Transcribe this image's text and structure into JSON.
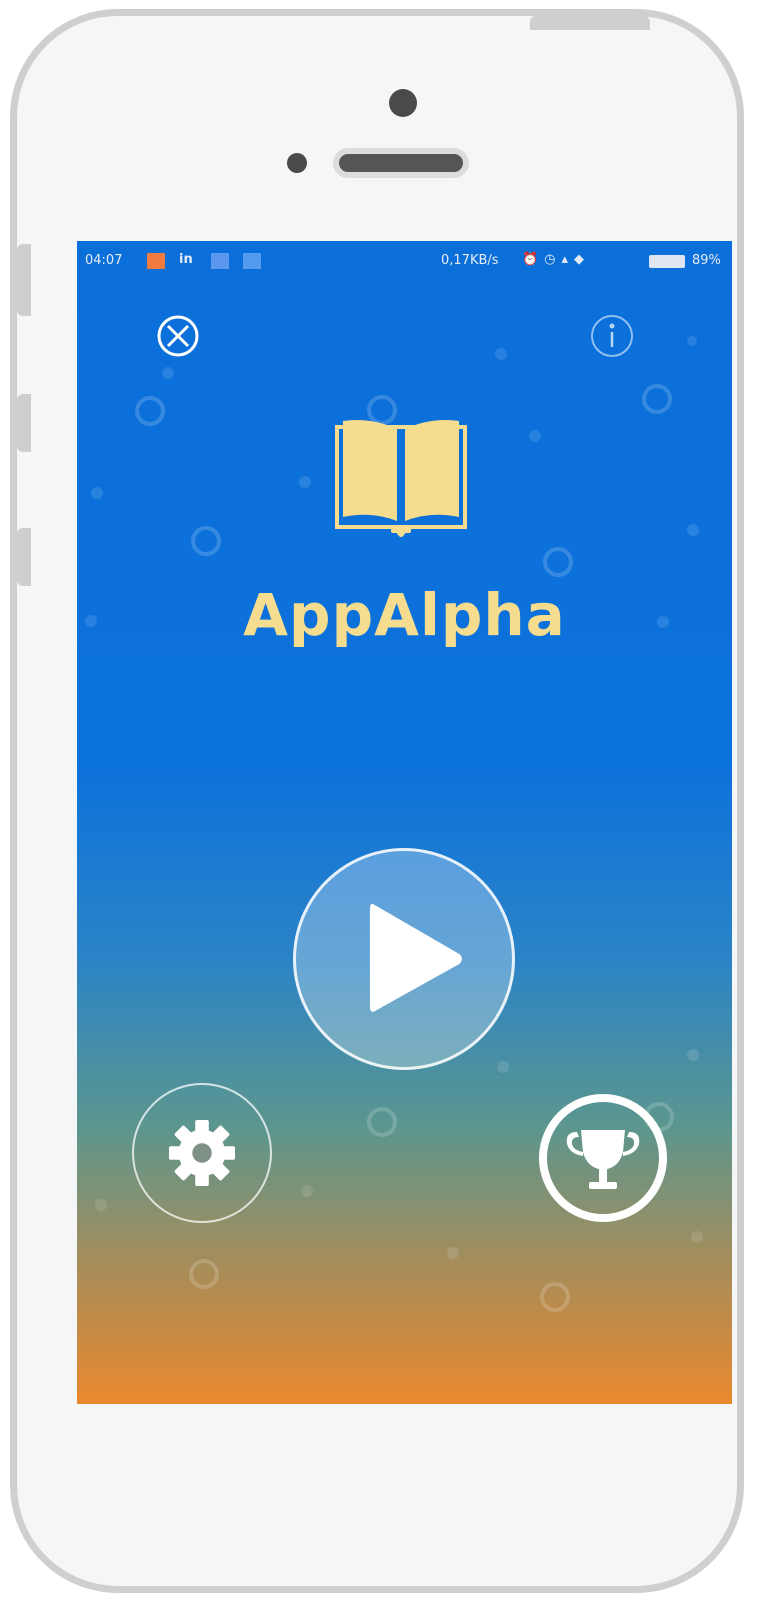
{
  "statusbar": {
    "time": "04:07",
    "network_speed": "0,17KB/s",
    "battery_percent": "89%",
    "indicator_colors": [
      "#f07b3f",
      "#9fb7ff",
      "#8fc0ff"
    ]
  },
  "app": {
    "title": "AppAlpha"
  },
  "header": {
    "left_icon": "close-circle-icon",
    "right_icon": "info-icon"
  },
  "controls": {
    "play_icon": "play-icon",
    "settings_icon": "gear-icon",
    "trophy_icon": "trophy-icon"
  },
  "colors": {
    "title": "#f6dc8e",
    "gradient_top": "#0b6fd9",
    "gradient_bottom": "#e9892e"
  }
}
